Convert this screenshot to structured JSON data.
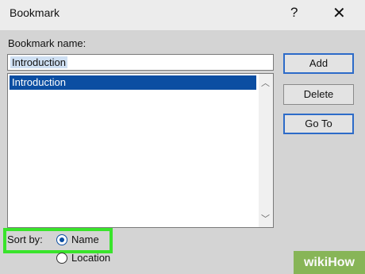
{
  "window": {
    "title": "Bookmark",
    "help_glyph": "?",
    "close_glyph": "✕"
  },
  "bookmark_name": {
    "label": "Bookmark name:",
    "value": "Introduction"
  },
  "bookmark_list": {
    "items": [
      "Introduction"
    ],
    "selected": "Introduction"
  },
  "buttons": {
    "add": "Add",
    "delete": "Delete",
    "goto": "Go To"
  },
  "sort": {
    "label": "Sort by:",
    "options": [
      {
        "label": "Name",
        "selected": true
      },
      {
        "label": "Location",
        "selected": false
      }
    ]
  },
  "watermark": {
    "text": "wikiHow"
  },
  "colors": {
    "highlight_box": "#39e42b",
    "selection": "#0b4ea2",
    "button_border": "#2d6bc8"
  }
}
